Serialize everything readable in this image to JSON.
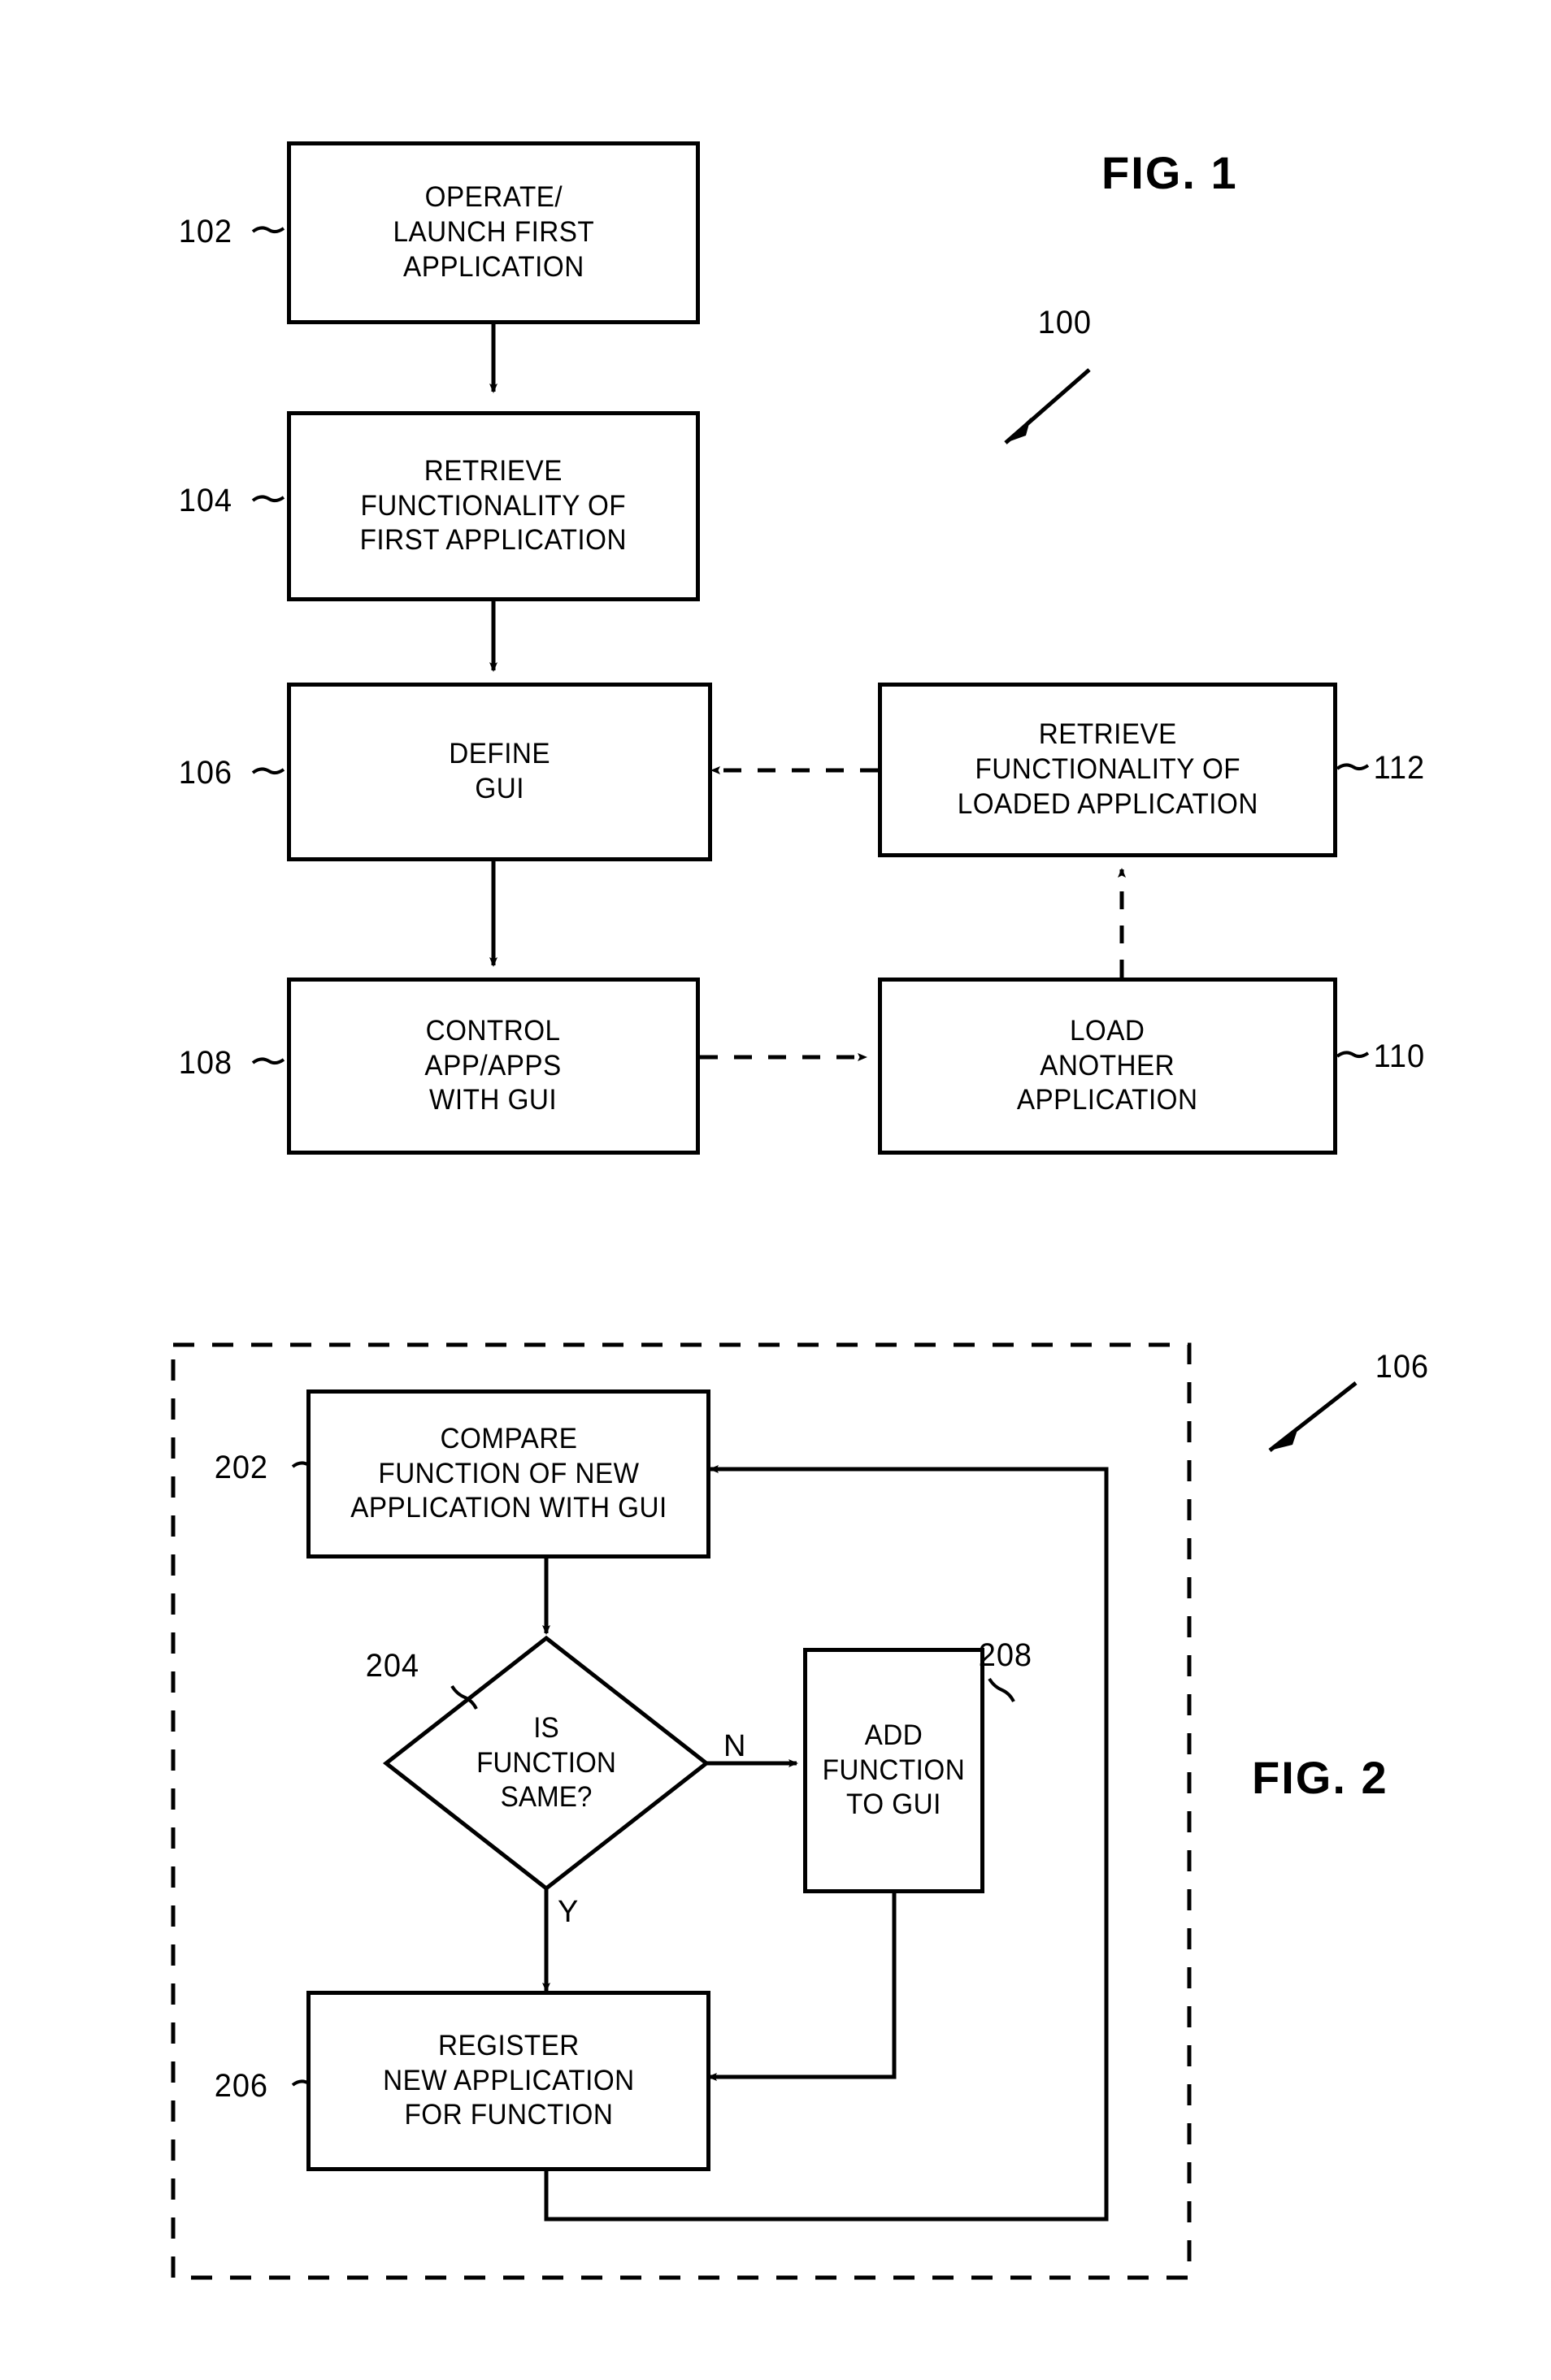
{
  "sheet": {
    "background_color": "#ffffff",
    "ink_color": "#000000"
  },
  "figures": [
    {
      "id": "fig-1",
      "title": "FIG. 1",
      "system_ref": "100",
      "nodes": [
        {
          "ref": "102",
          "type": "process",
          "text": "OPERATE/\nLAUNCH FIRST\nAPPLICATION"
        },
        {
          "ref": "104",
          "type": "process",
          "text": "RETRIEVE\nFUNCTIONALITY  OF\nFIRST  APPLICATION"
        },
        {
          "ref": "106",
          "type": "process",
          "text": "DEFINE\nGUI"
        },
        {
          "ref": "108",
          "type": "process",
          "text": "CONTROL\nAPP/APPS\nWITH  GUI"
        },
        {
          "ref": "110",
          "type": "process",
          "text": "LOAD\nANOTHER\nAPPLICATION"
        },
        {
          "ref": "112",
          "type": "process",
          "text": "RETRIEVE\nFUNCTIONALITY  OF\nLOADED  APPLICATION"
        }
      ],
      "edges": [
        {
          "from": "102",
          "to": "104",
          "style": "solid"
        },
        {
          "from": "104",
          "to": "106",
          "style": "solid"
        },
        {
          "from": "106",
          "to": "108",
          "style": "solid"
        },
        {
          "from": "108",
          "to": "110",
          "style": "dashed"
        },
        {
          "from": "110",
          "to": "112",
          "style": "dashed"
        },
        {
          "from": "112",
          "to": "106",
          "style": "dashed"
        }
      ]
    },
    {
      "id": "fig-2",
      "title": "FIG. 2",
      "system_ref": "106",
      "nodes": [
        {
          "ref": "202",
          "type": "process",
          "text": "COMPARE\nFUNCTION  OF  NEW\nAPPLICATION  WITH  GUI"
        },
        {
          "ref": "204",
          "type": "decision",
          "text": "IS\nFUNCTION\nSAME?"
        },
        {
          "ref": "206",
          "type": "process",
          "text": "REGISTER\nNEW  APPLICATION\nFOR  FUNCTION"
        },
        {
          "ref": "208",
          "type": "process",
          "text": "ADD\nFUNCTION\nTO  GUI"
        }
      ],
      "edges": [
        {
          "from": "202",
          "to": "204",
          "style": "solid",
          "label": ""
        },
        {
          "from": "204",
          "to": "208",
          "style": "solid",
          "label": "N"
        },
        {
          "from": "204",
          "to": "206",
          "style": "solid",
          "label": "Y"
        },
        {
          "from": "208",
          "to": "206",
          "style": "solid",
          "label": ""
        },
        {
          "from": "206",
          "to": "202",
          "style": "solid",
          "label": ""
        }
      ],
      "branch_labels": {
        "no": "N",
        "yes": "Y"
      },
      "container": {
        "style": "dashed",
        "ref": "106"
      }
    }
  ]
}
